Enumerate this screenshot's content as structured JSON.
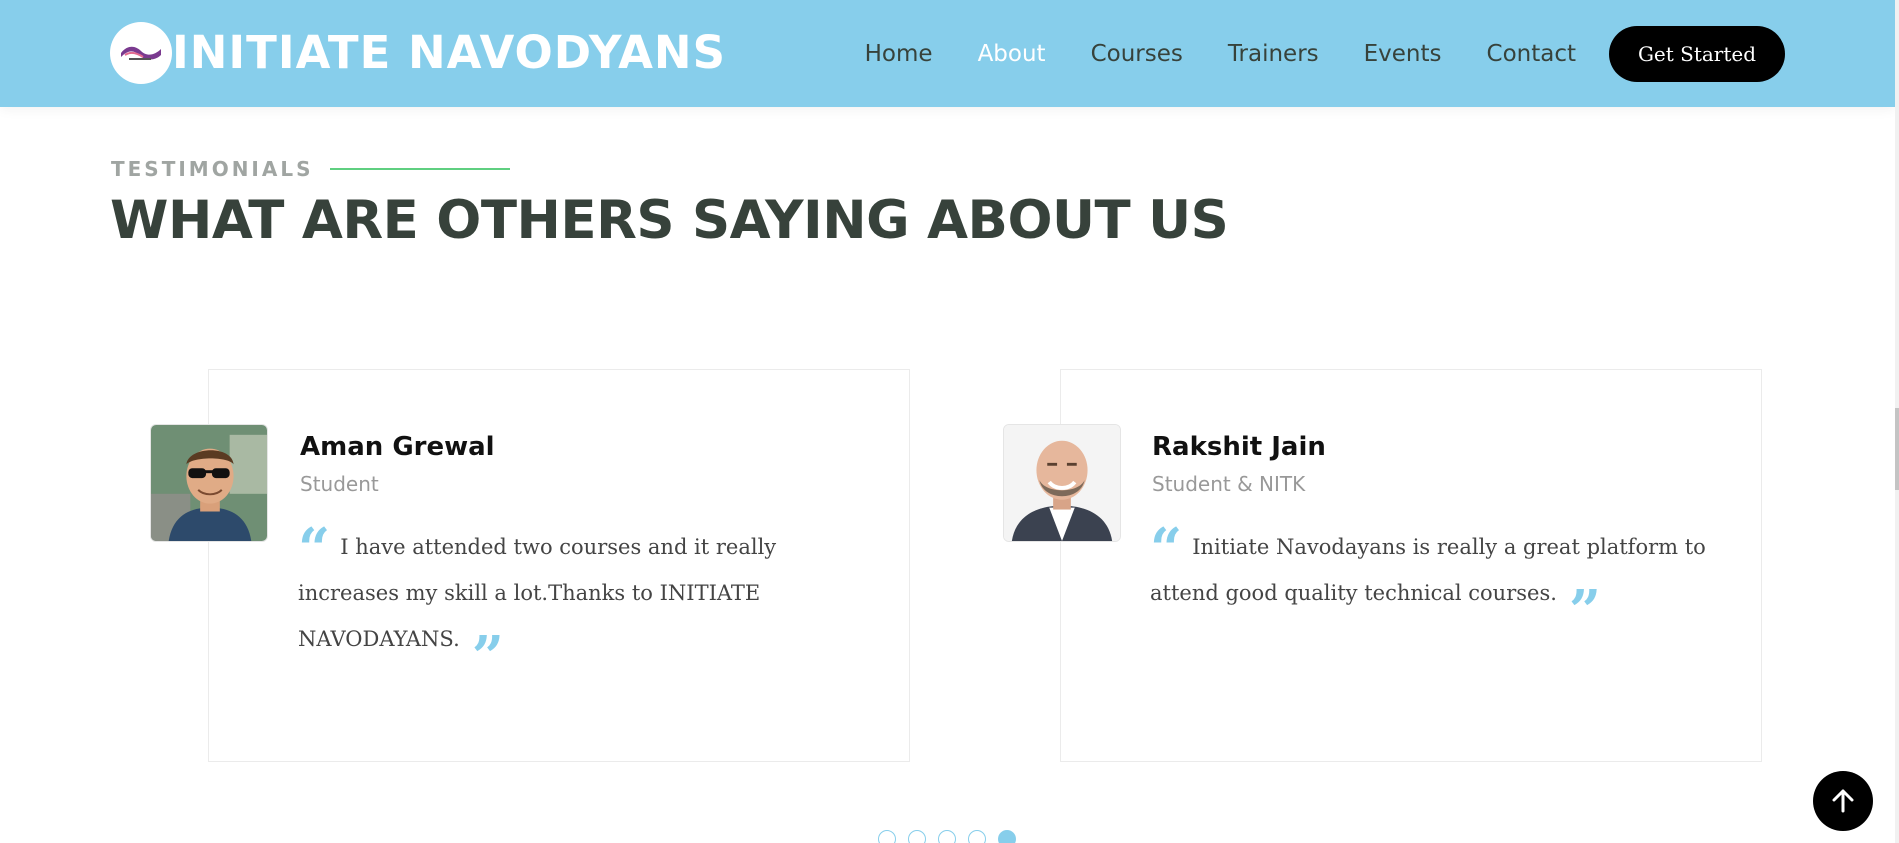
{
  "header": {
    "logo_icon": "logo-badge-icon",
    "brand": "INITIATE NAVODYANS",
    "nav": [
      {
        "label": "Home",
        "active": false
      },
      {
        "label": "About",
        "active": true
      },
      {
        "label": "Courses",
        "active": false
      },
      {
        "label": "Trainers",
        "active": false
      },
      {
        "label": "Events",
        "active": false
      },
      {
        "label": "Contact",
        "active": false
      }
    ],
    "cta": "Get Started"
  },
  "section": {
    "eyebrow": "TESTIMONIALS",
    "title": "WHAT ARE OTHERS SAYING ABOUT US"
  },
  "testimonials": [
    {
      "name": "Aman Grewal",
      "role": "Student",
      "quote": "I have attended two courses and it really increases my skill a lot.Thanks to INITIATE NAVODAYANS."
    },
    {
      "name": "Rakshit Jain",
      "role": "Student & NITK",
      "quote": "Initiate Navodayans is really a great platform to attend good quality technical courses."
    }
  ],
  "carousel": {
    "dots": 5,
    "active_index": 4
  },
  "colors": {
    "accent": "#87ceeb",
    "heading": "#37423b",
    "eyebrow_line": "#5fcf80"
  },
  "icons": {
    "open_quote": "quote-open-icon",
    "close_quote": "quote-close-icon",
    "back_to_top": "arrow-up-icon"
  }
}
